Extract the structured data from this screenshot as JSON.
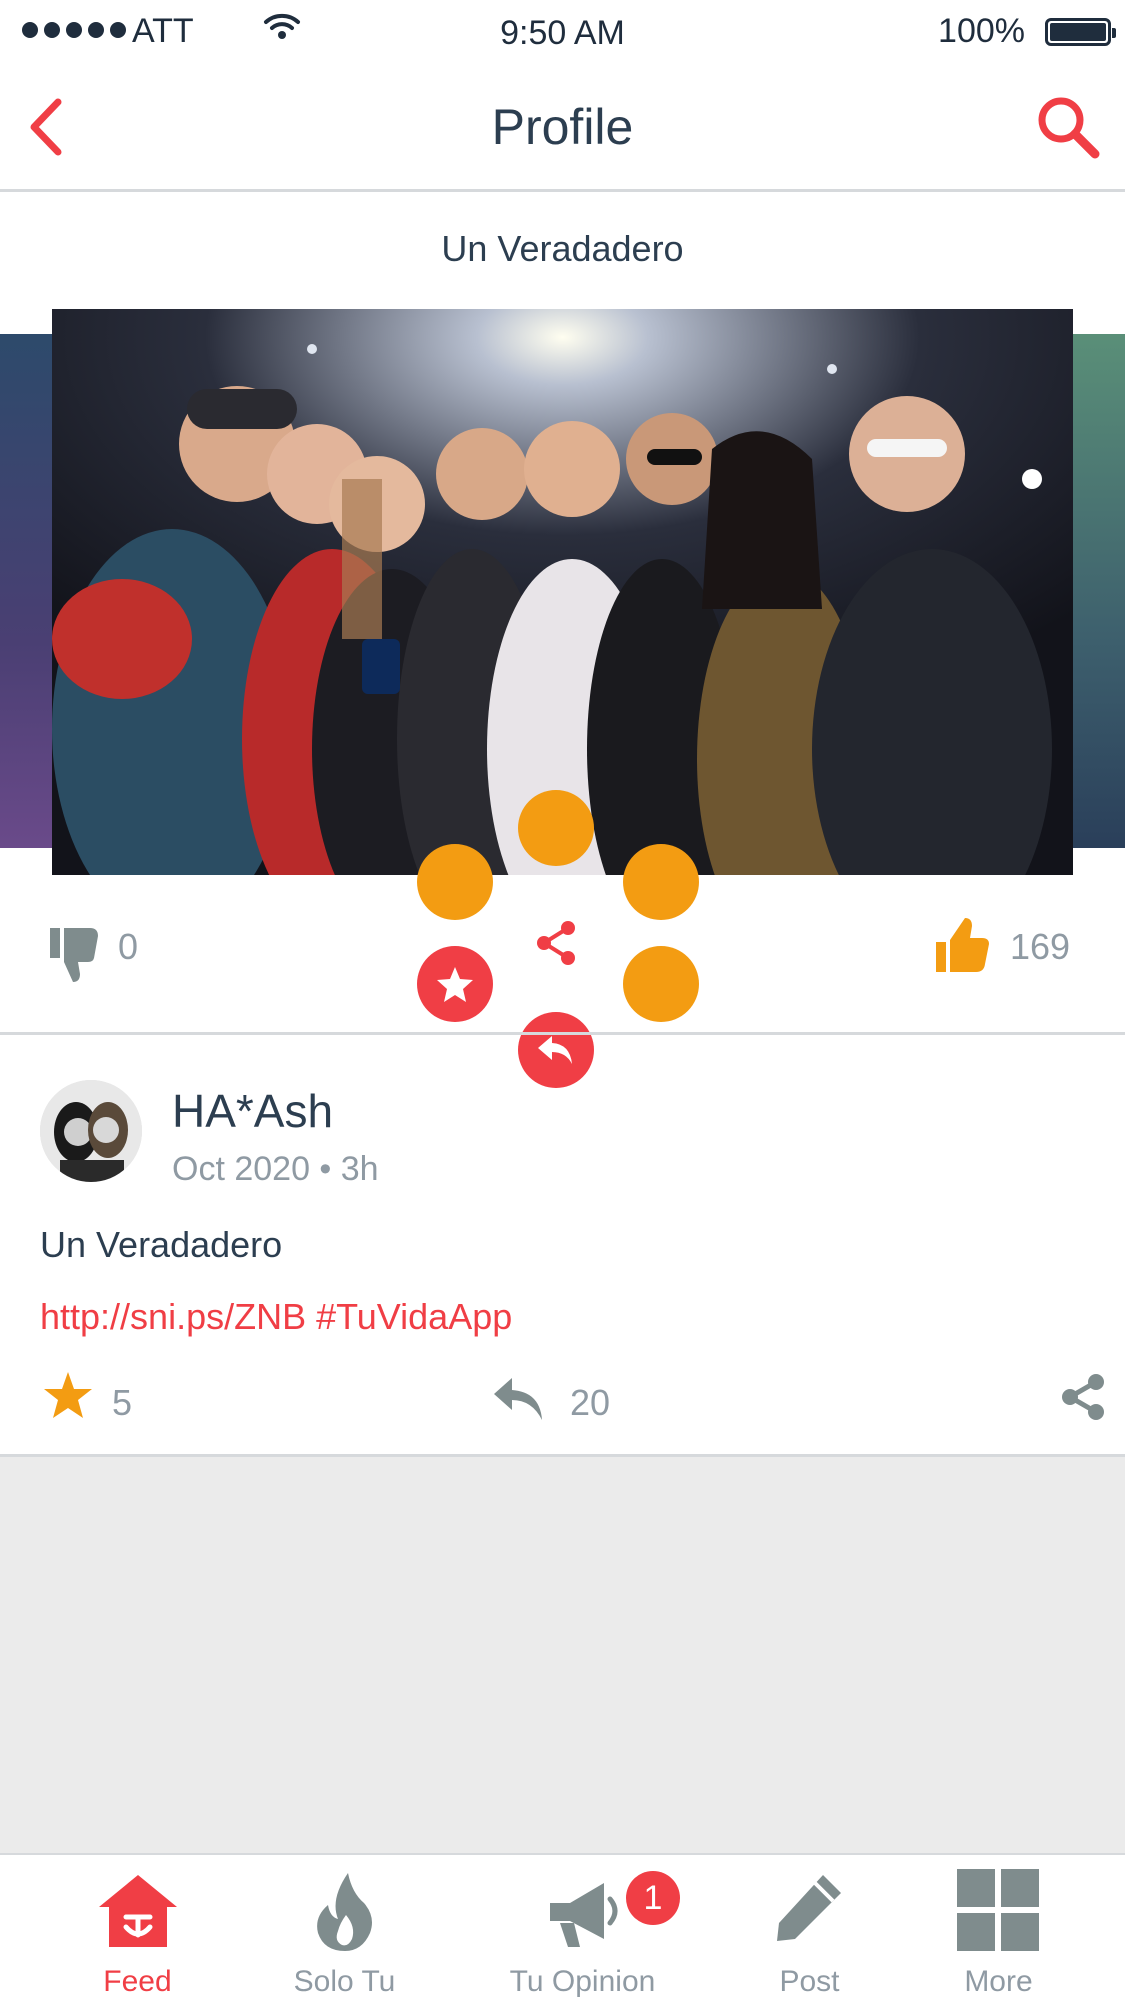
{
  "status_bar": {
    "carrier": "ATT",
    "time": "9:50 AM",
    "battery": "100%"
  },
  "nav": {
    "title": "Profile"
  },
  "post": {
    "header_caption": "Un Veradadero",
    "dislikes": "0",
    "likes": "169",
    "author": "HA*Ash",
    "meta": "Oct 2020 • 3h",
    "text": "Un Veradadero",
    "link": "http://sni.ps/ZNB #TuVidaApp",
    "stars": "5",
    "replies": "20"
  },
  "tabs": [
    {
      "label": "Feed",
      "icon": "home-icon",
      "active": true
    },
    {
      "label": "Solo Tu",
      "icon": "flame-icon"
    },
    {
      "label": "Tu Opinion",
      "icon": "megaphone-icon",
      "badge": "1"
    },
    {
      "label": "Post",
      "icon": "pencil-icon"
    },
    {
      "label": "More",
      "icon": "grid-icon"
    }
  ],
  "colors": {
    "accent": "#f03e45",
    "orange": "#f39c12",
    "text": "#2c3e50",
    "muted": "#8f9aa3"
  }
}
